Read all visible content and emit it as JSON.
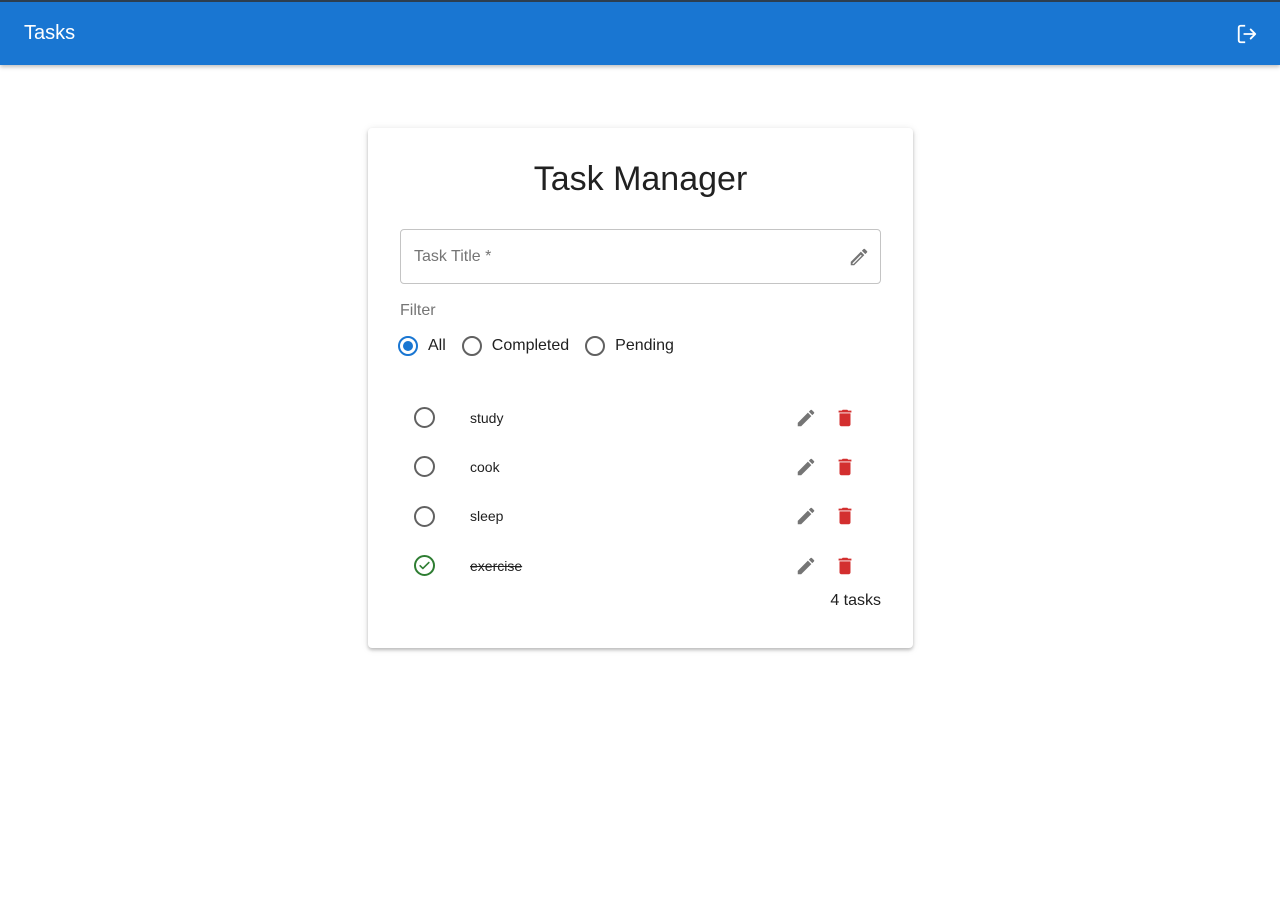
{
  "app": {
    "title": "Tasks"
  },
  "card": {
    "title": "Task Manager"
  },
  "task_input": {
    "placeholder": "Task Title *",
    "value": ""
  },
  "filter": {
    "label": "Filter",
    "options": [
      {
        "label": "All",
        "selected": true
      },
      {
        "label": "Completed",
        "selected": false
      },
      {
        "label": "Pending",
        "selected": false
      }
    ]
  },
  "tasks": [
    {
      "title": "study",
      "completed": false
    },
    {
      "title": "cook",
      "completed": false
    },
    {
      "title": "sleep",
      "completed": false
    },
    {
      "title": "exercise",
      "completed": true
    }
  ],
  "task_count": "4 tasks",
  "icons": {
    "logout": "logout-icon",
    "edit": "pencil-icon",
    "delete": "trash-icon",
    "completed": "check-circle-icon"
  },
  "colors": {
    "primary": "#1976d2",
    "delete": "#d32f2f",
    "completed": "#2e7d32",
    "icon_gray": "#757575"
  }
}
